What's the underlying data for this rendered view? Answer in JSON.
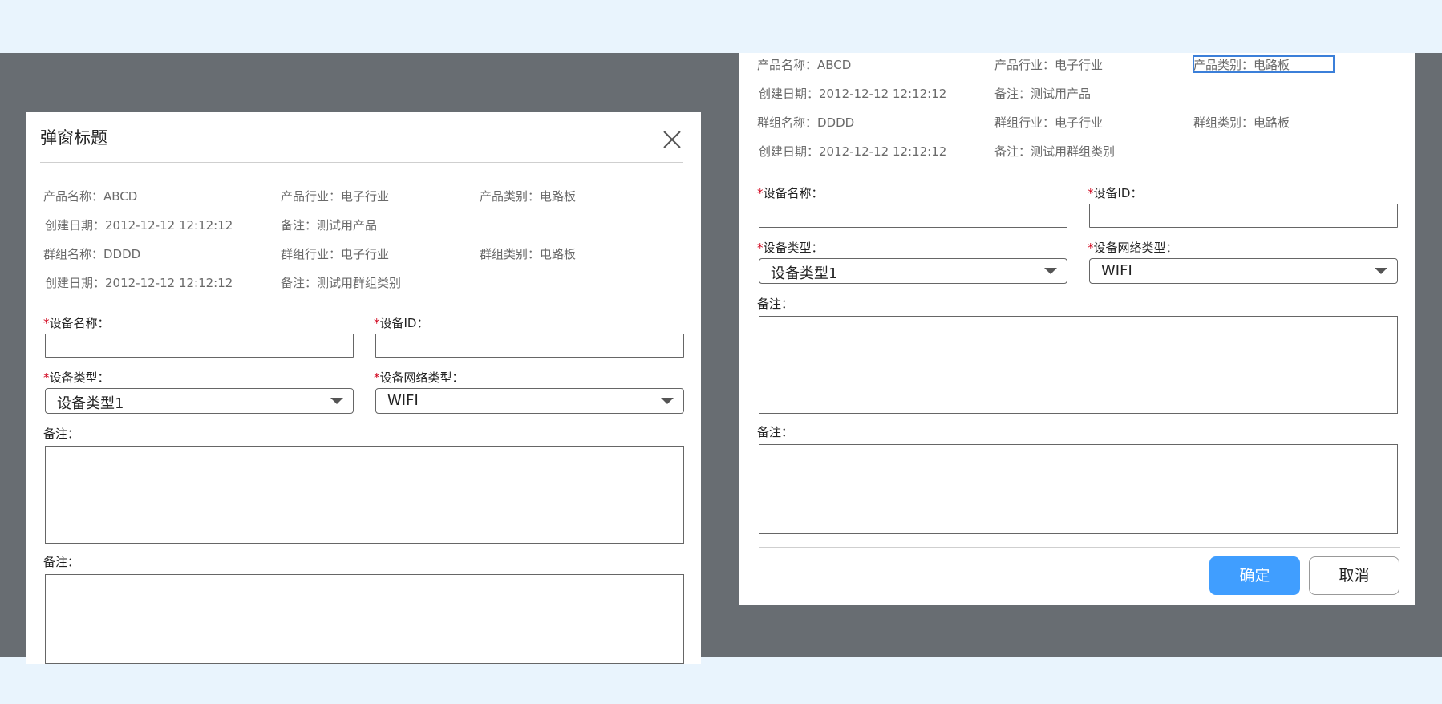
{
  "left_dialog": {
    "title": "弹窗标题",
    "info_rows": [
      [
        "产品名称：ABCD",
        "产品行业：电子行业",
        "产品类别：电路板"
      ],
      [
        "创建日期：2012-12-12 12:12:12",
        "备注：测试用产品",
        ""
      ],
      [
        "群组名称：DDDD",
        "群组行业：电子行业",
        "群组类别：电路板"
      ],
      [
        "创建日期：2012-12-12 12:12:12",
        "备注：测试用群组类别",
        ""
      ]
    ],
    "form": {
      "required_mark": "*",
      "device_name_label": "设备名称：",
      "device_name_value": "",
      "device_id_label": "设备ID：",
      "device_id_value": "",
      "device_type_label": "设备类型：",
      "device_type_value": "设备类型1",
      "network_type_label": "设备网络类型：",
      "network_type_value": "WIFI",
      "remark1_label": "备注：",
      "remark2_label": "备注："
    }
  },
  "right_dialog": {
    "info_rows": [
      [
        "产品名称：ABCD",
        "产品行业：电子行业",
        "产品类别：电路板"
      ],
      [
        "创建日期：2012-12-12 12:12:12",
        "备注：测试用产品",
        ""
      ],
      [
        "群组名称：DDDD",
        "群组行业：电子行业",
        "群组类别：电路板"
      ],
      [
        "创建日期：2012-12-12 12:12:12",
        "备注：测试用群组类别",
        ""
      ]
    ],
    "form": {
      "required_mark": "*",
      "device_name_label": "设备名称：",
      "device_id_label": "设备ID：",
      "device_type_label": "设备类型：",
      "device_type_value": "设备类型1",
      "network_type_label": "设备网络类型：",
      "network_type_value": "WIFI",
      "remark1_label": "备注：",
      "remark2_label": "备注："
    },
    "buttons": {
      "confirm": "确定",
      "cancel": "取消"
    }
  },
  "colors": {
    "page_background": "#e9f4fd",
    "overlay": "#686d72",
    "primary": "#409eff",
    "required": "#d0021b"
  },
  "icons": [
    "close-icon",
    "chevron-down-icon"
  ]
}
